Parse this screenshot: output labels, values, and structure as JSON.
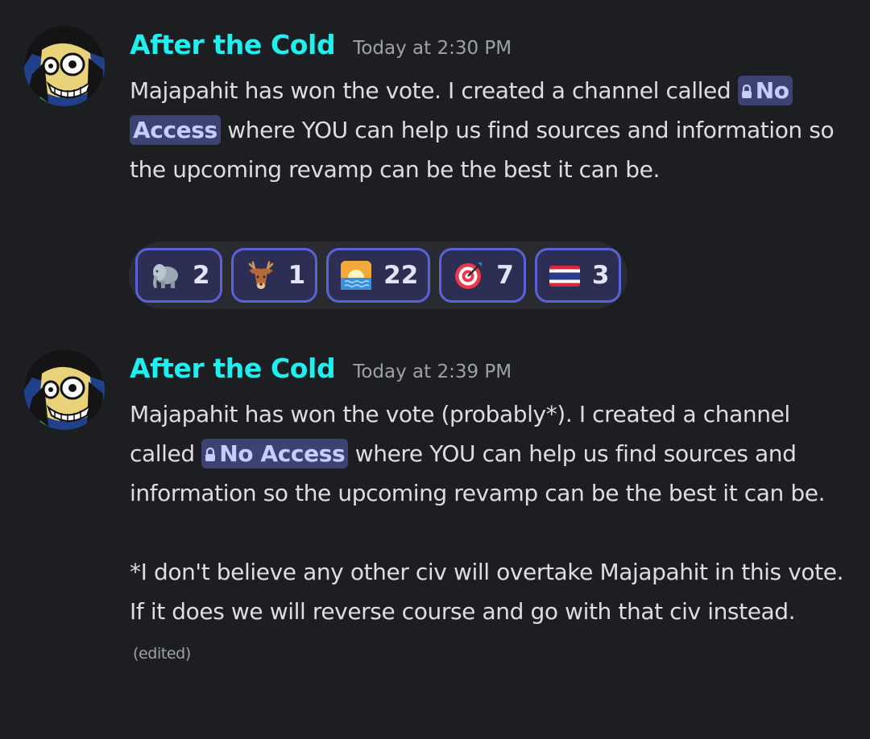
{
  "messages": [
    {
      "author": "After the Cold",
      "timestamp": "Today at 2:30 PM",
      "text_before": "Majapahit has won the vote. I created a channel called ",
      "channel_name": "No Access",
      "text_after": " where YOU can help us find sources and information so the upcoming revamp can be the best it can be.",
      "reactions": [
        {
          "emoji": "elephant-emoji",
          "count": "2"
        },
        {
          "emoji": "deer-emoji",
          "count": "1"
        },
        {
          "emoji": "sunrise-over-water-emoji",
          "count": "22"
        },
        {
          "emoji": "bullseye-target-emoji",
          "count": "7"
        },
        {
          "emoji": "thailand-flag-emoji",
          "count": "3"
        }
      ]
    },
    {
      "author": "After the Cold",
      "timestamp": "Today at 2:39 PM",
      "text_before": "Majapahit has won the vote (probably*). I created a channel called ",
      "channel_name": "No Access",
      "text_after": " where YOU can help us find sources and information so the upcoming revamp can be the best it can be.",
      "footnote": "*I don't believe any other civ will overtake Majapahit in this vote. If it does we will reverse course and go with that civ instead.",
      "edited_label": "(edited)"
    }
  ],
  "colors": {
    "background": "#1d1e22",
    "username": "#1ef0f0",
    "timestamp": "#9fa1a8",
    "mention_bg": "#3c4271",
    "reaction_border": "#5a62d9"
  }
}
